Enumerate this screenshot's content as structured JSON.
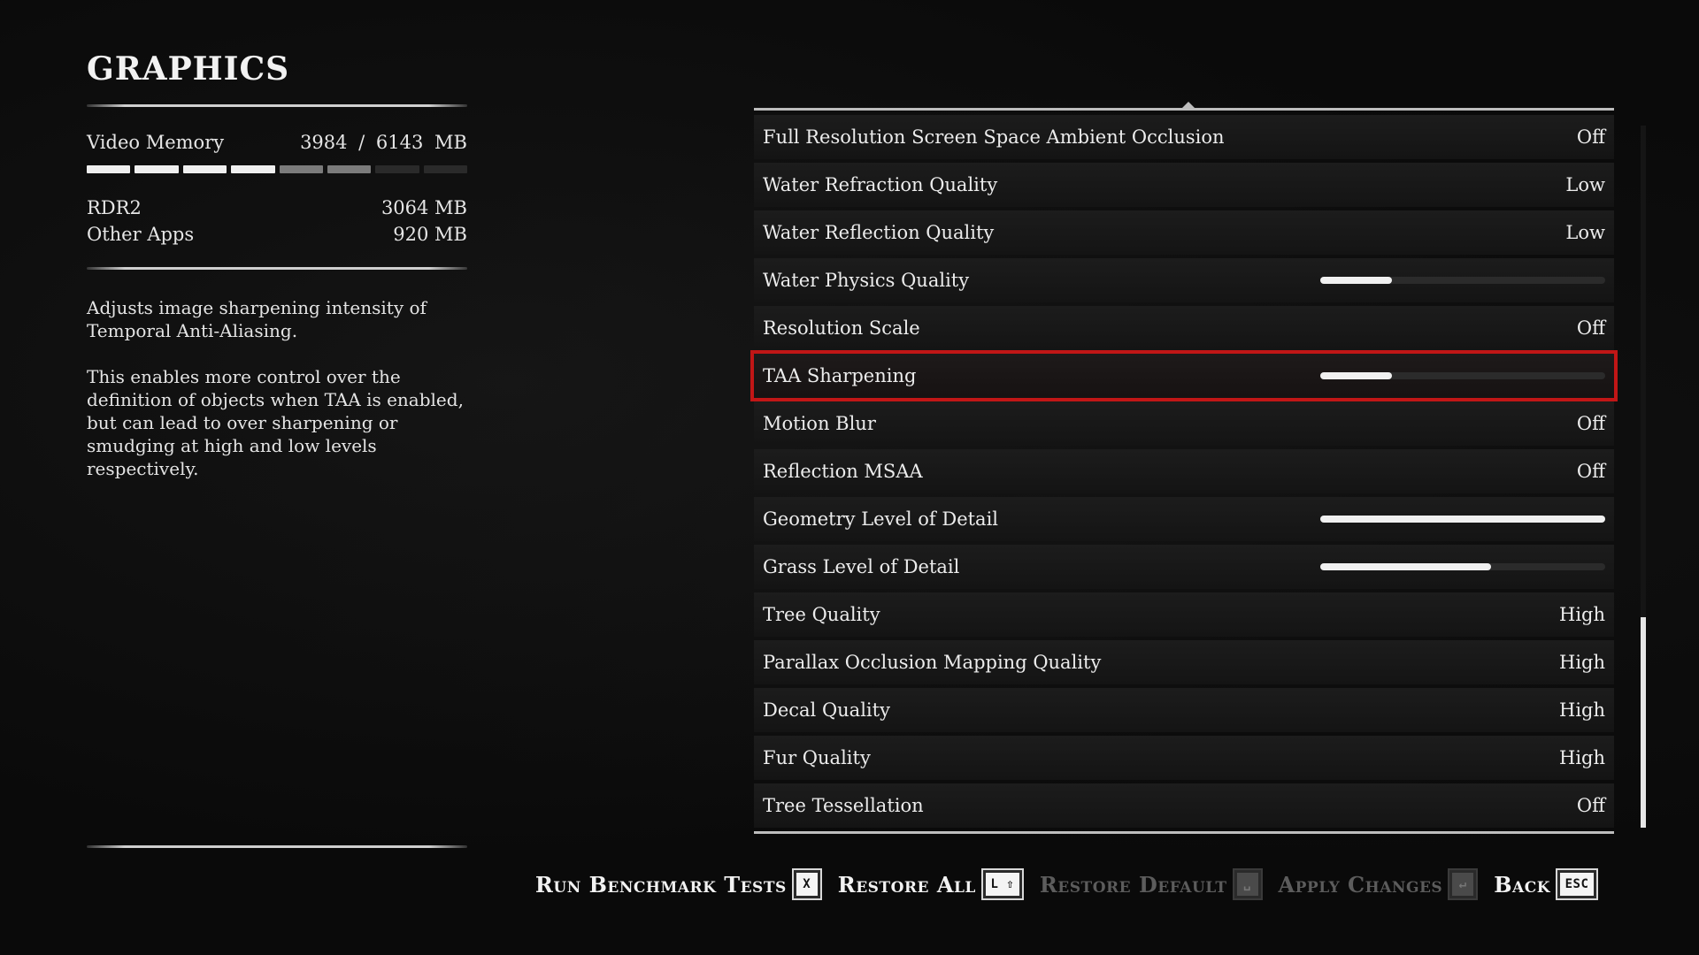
{
  "page": {
    "title": "GRAPHICS"
  },
  "memory": {
    "label": "Video Memory",
    "usage": "3984  /  6143  MB",
    "segments_total": 8,
    "used_fraction": 0.649,
    "rdr2_fraction": 0.499,
    "items": [
      {
        "label": "RDR2",
        "value": "3064  MB"
      },
      {
        "label": "Other Apps",
        "value": "920  MB"
      }
    ]
  },
  "description": [
    "Adjusts image sharpening intensity of Temporal Anti-Aliasing.",
    "This enables more control over the definition of objects when TAA is enabled, but can lead to over sharpening or smudging at high and low levels respectively."
  ],
  "settings": [
    {
      "label": "Full Resolution Screen Space Ambient Occlusion",
      "value": "Off"
    },
    {
      "label": "Water Refraction Quality",
      "value": "Low"
    },
    {
      "label": "Water Reflection Quality",
      "value": "Low"
    },
    {
      "label": "Water Physics Quality",
      "slider": 0.25
    },
    {
      "label": "Resolution Scale",
      "value": "Off"
    },
    {
      "label": "TAA Sharpening",
      "slider": 0.25,
      "selected": true
    },
    {
      "label": "Motion Blur",
      "value": "Off"
    },
    {
      "label": "Reflection MSAA",
      "value": "Off"
    },
    {
      "label": "Geometry Level of Detail",
      "slider": 1.0
    },
    {
      "label": "Grass Level of Detail",
      "slider": 0.6
    },
    {
      "label": "Tree Quality",
      "value": "High"
    },
    {
      "label": "Parallax Occlusion Mapping Quality",
      "value": "High"
    },
    {
      "label": "Decal Quality",
      "value": "High"
    },
    {
      "label": "Fur Quality",
      "value": "High"
    },
    {
      "label": "Tree Tessellation",
      "value": "Off"
    }
  ],
  "scroll": {
    "thumb_start": 0.7,
    "thumb_fraction": 0.3
  },
  "actions": [
    {
      "name": "run-benchmark-button",
      "label": "Run Benchmark Tests",
      "key": "X",
      "enabled": true
    },
    {
      "name": "restore-all-button",
      "label": "Restore All",
      "key": "L ⇧",
      "enabled": true
    },
    {
      "name": "restore-default-button",
      "label": "Restore Default",
      "key": "␣",
      "enabled": false
    },
    {
      "name": "apply-changes-button",
      "label": "Apply Changes",
      "key": "↵",
      "enabled": false
    },
    {
      "name": "back-button",
      "label": "Back",
      "key": "ESC",
      "enabled": true
    }
  ],
  "colors": {
    "selection": "#c11616",
    "text": "#ececec",
    "disabled": "#5c5c5c"
  }
}
